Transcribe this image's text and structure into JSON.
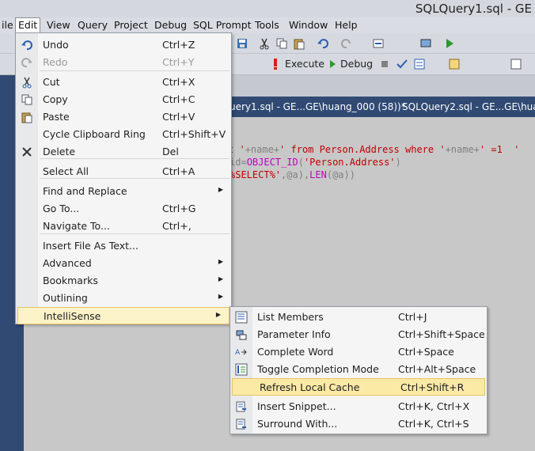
{
  "window": {
    "title": "SQLQuery1.sql - GE"
  },
  "menubar": [
    {
      "label": "ile"
    },
    {
      "label": "Edit"
    },
    {
      "label": "View"
    },
    {
      "label": "Query"
    },
    {
      "label": "Project"
    },
    {
      "label": "Debug"
    },
    {
      "label": "SQL Prompt"
    },
    {
      "label": "Tools"
    },
    {
      "label": "Window"
    },
    {
      "label": "Help"
    }
  ],
  "toolbar": {
    "execute_label": "Execute",
    "debug_label": "Debug",
    "icons": [
      "save-icon",
      "cut-icon",
      "copy-icon",
      "paste-icon",
      "undo-icon",
      "redo-icon",
      "navigate-icon",
      "start-icon",
      "execute-icon",
      "stop-icon",
      "parse-icon"
    ]
  },
  "tabs": [
    {
      "label": "uery1.sql - GE...GE\\huang_000 (58))*"
    },
    {
      "label": "SQLQuery2.sql - GE...GE\\huang_"
    }
  ],
  "editor": {
    "lines": [
      {
        "parts": [
          [
            "t '",
            "#c00000"
          ],
          [
            "+name+",
            "#808080"
          ],
          [
            "' from Person.Address where '",
            "#c00000"
          ],
          [
            "+name+",
            "#808080"
          ],
          [
            "' =1  '",
            "#c00000"
          ]
        ]
      },
      {
        "parts": [
          [
            "id=",
            "#808080"
          ],
          [
            "OBJECT_ID",
            "#c000c0"
          ],
          [
            "(",
            "#808080"
          ],
          [
            "'Person.Address'",
            "#c00000"
          ],
          [
            ")",
            "#808080"
          ]
        ]
      },
      {
        "parts": [
          [
            "%SELECT%'",
            "#c00000"
          ],
          [
            ",@a),",
            "#808080"
          ],
          [
            "LEN",
            "#c000c0"
          ],
          [
            "(@a))",
            "#808080"
          ]
        ]
      }
    ]
  },
  "edit_menu": {
    "items": [
      {
        "label": "Undo",
        "shortcut": "Ctrl+Z",
        "icon": "undo-icon",
        "enabled": true
      },
      {
        "label": "Redo",
        "shortcut": "Ctrl+Y",
        "icon": "redo-icon",
        "enabled": false
      },
      {
        "label": "Cut",
        "shortcut": "Ctrl+X",
        "icon": "cut-icon",
        "enabled": true
      },
      {
        "label": "Copy",
        "shortcut": "Ctrl+C",
        "icon": "copy-icon",
        "enabled": true
      },
      {
        "label": "Paste",
        "shortcut": "Ctrl+V",
        "icon": "paste-icon",
        "enabled": true
      },
      {
        "label": "Cycle Clipboard Ring",
        "shortcut": "Ctrl+Shift+V",
        "icon": "",
        "enabled": true
      },
      {
        "label": "Delete",
        "shortcut": "Del",
        "icon": "delete-icon",
        "enabled": true
      },
      {
        "label": "Select All",
        "shortcut": "Ctrl+A",
        "icon": "",
        "enabled": true
      },
      {
        "label": "Find and Replace",
        "shortcut": "",
        "icon": "",
        "submenu": true,
        "enabled": true
      },
      {
        "label": "Go To...",
        "shortcut": "Ctrl+G",
        "icon": "",
        "enabled": true
      },
      {
        "label": "Navigate To...",
        "shortcut": "Ctrl+,",
        "icon": "",
        "enabled": true
      },
      {
        "label": "Insert File As Text...",
        "shortcut": "",
        "icon": "",
        "enabled": true
      },
      {
        "label": "Advanced",
        "shortcut": "",
        "icon": "",
        "submenu": true,
        "enabled": true
      },
      {
        "label": "Bookmarks",
        "shortcut": "",
        "icon": "",
        "submenu": true,
        "enabled": true
      },
      {
        "label": "Outlining",
        "shortcut": "",
        "icon": "",
        "submenu": true,
        "enabled": true
      },
      {
        "label": "IntelliSense",
        "shortcut": "",
        "icon": "",
        "submenu": true,
        "enabled": true
      }
    ]
  },
  "intellisense_menu": {
    "items": [
      {
        "label": "List Members",
        "shortcut": "Ctrl+J",
        "icon": "list-members-icon"
      },
      {
        "label": "Parameter Info",
        "shortcut": "Ctrl+Shift+Space",
        "icon": "parameter-info-icon"
      },
      {
        "label": "Complete Word",
        "shortcut": "Ctrl+Space",
        "icon": "complete-word-icon"
      },
      {
        "label": "Toggle Completion Mode",
        "shortcut": "Ctrl+Alt+Space",
        "icon": "toggle-completion-icon"
      },
      {
        "label": "Refresh Local Cache",
        "shortcut": "Ctrl+Shift+R",
        "icon": "refresh-cache-icon"
      },
      {
        "label": "Insert Snippet...",
        "shortcut": "Ctrl+K, Ctrl+X",
        "icon": "insert-snippet-icon"
      },
      {
        "label": "Surround With...",
        "shortcut": "Ctrl+K, Ctrl+S",
        "icon": "surround-with-icon"
      }
    ]
  },
  "colors": {
    "accent": "#304a73",
    "highlight": "#fcf3c8",
    "highlight_border": "#e5c365"
  }
}
